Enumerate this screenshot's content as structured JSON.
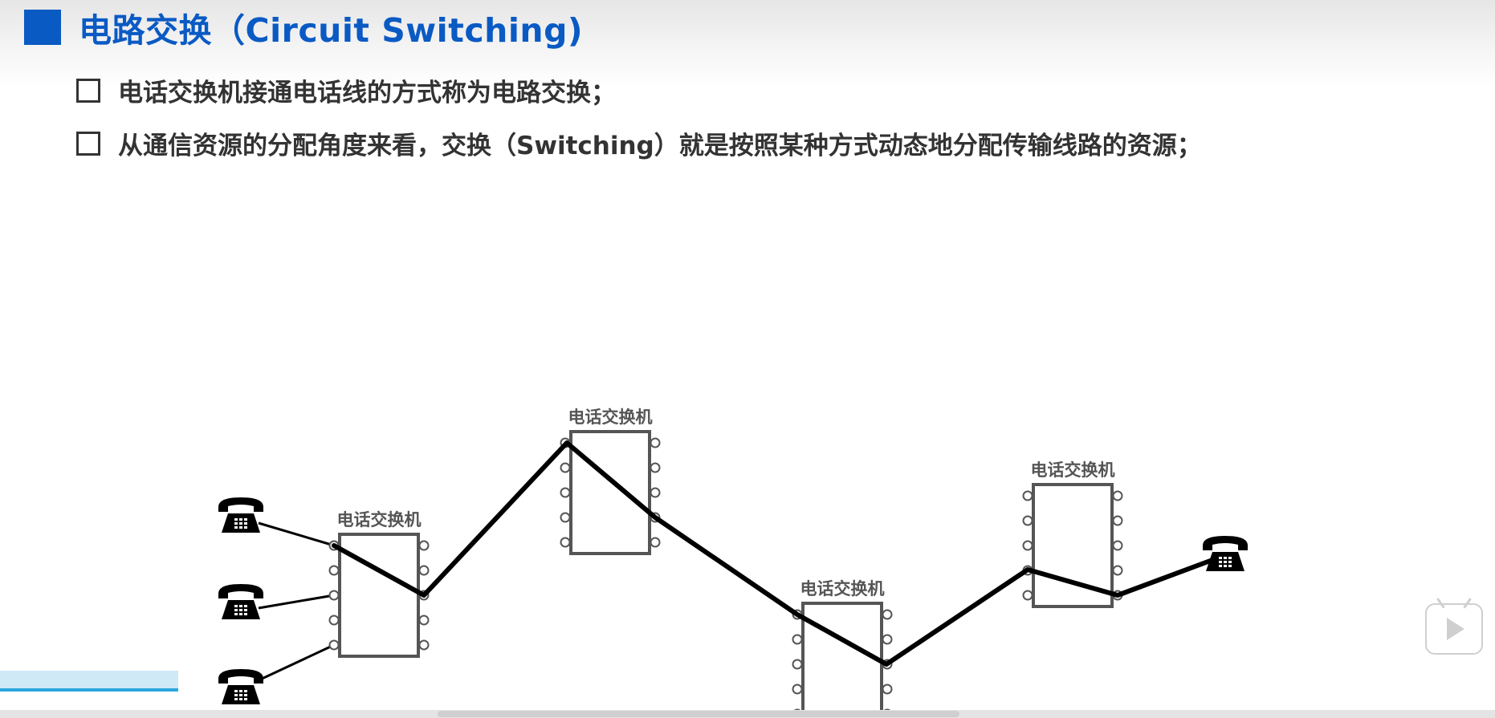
{
  "title": "电路交换（Circuit Switching)",
  "bullets": [
    "电话交换机接通电话线的方式称为电路交换；",
    "从通信资源的分配角度来看，交换（Switching）就是按照某种方式动态地分配传输线路的资源；"
  ],
  "diagram": {
    "switch_label": "电话交换机",
    "colors": {
      "accent": "#0a5ac4",
      "line": "#000000",
      "switch_border": "#555555"
    }
  }
}
